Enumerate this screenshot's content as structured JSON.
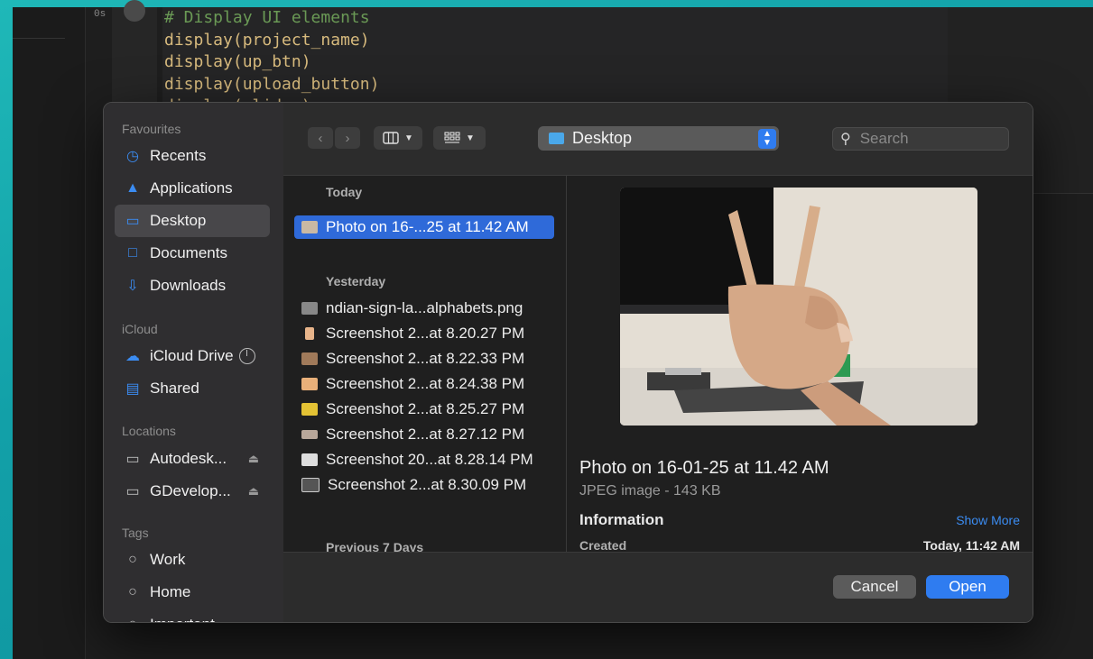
{
  "editor": {
    "cell_time": "0s",
    "code_lines": [
      "# Display UI elements",
      "display(project_name)",
      "display(up_btn)",
      "display(upload_button)",
      "display(slider)"
    ]
  },
  "sidebar": {
    "favourites_label": "Favourites",
    "favourites": [
      {
        "label": "Recents",
        "icon": "clock-icon"
      },
      {
        "label": "Applications",
        "icon": "applications-icon"
      },
      {
        "label": "Desktop",
        "icon": "desktop-icon",
        "selected": true
      },
      {
        "label": "Documents",
        "icon": "document-icon"
      },
      {
        "label": "Downloads",
        "icon": "download-icon"
      }
    ],
    "icloud_label": "iCloud",
    "icloud": [
      {
        "label": "iCloud Drive",
        "icon": "cloud-icon"
      },
      {
        "label": "Shared",
        "icon": "shared-folder-icon"
      }
    ],
    "locations_label": "Locations",
    "locations": [
      {
        "label": "Autodesk...",
        "icon": "drive-icon"
      },
      {
        "label": "GDevelop...",
        "icon": "drive-icon"
      }
    ],
    "tags_label": "Tags",
    "tags": [
      {
        "label": "Work"
      },
      {
        "label": "Home"
      },
      {
        "label": "Important"
      }
    ]
  },
  "toolbar": {
    "back": "‹",
    "forward": "›",
    "location": "Desktop",
    "search_placeholder": "Search"
  },
  "files": {
    "today_label": "Today",
    "today": [
      {
        "name": "Photo on 16-...25 at 11.42 AM",
        "selected": true
      }
    ],
    "yesterday_label": "Yesterday",
    "yesterday": [
      {
        "name": "ndian-sign-la...alphabets.png"
      },
      {
        "name": "Screenshot 2...at 8.20.27 PM"
      },
      {
        "name": "Screenshot 2...at 8.22.33 PM"
      },
      {
        "name": "Screenshot 2...at 8.24.38 PM"
      },
      {
        "name": "Screenshot 2...at 8.25.27 PM"
      },
      {
        "name": "Screenshot 2...at 8.27.12 PM"
      },
      {
        "name": "Screenshot 20...at 8.28.14 PM"
      },
      {
        "name": "Screenshot 2...at 8.30.09 PM"
      }
    ],
    "previous_label": "Previous 7 Days"
  },
  "preview": {
    "name": "Photo on 16-01-25 at 11.42 AM",
    "type": "JPEG image - 143 KB",
    "info_label": "Information",
    "show_more": "Show More",
    "created_label": "Created",
    "created_value": "Today, 11:42 AM"
  },
  "footer": {
    "cancel": "Cancel",
    "open": "Open"
  },
  "colors": {
    "accent": "#2f7cf0",
    "selection": "#2f6ad9",
    "dialog_bg": "#2a2a2a"
  }
}
